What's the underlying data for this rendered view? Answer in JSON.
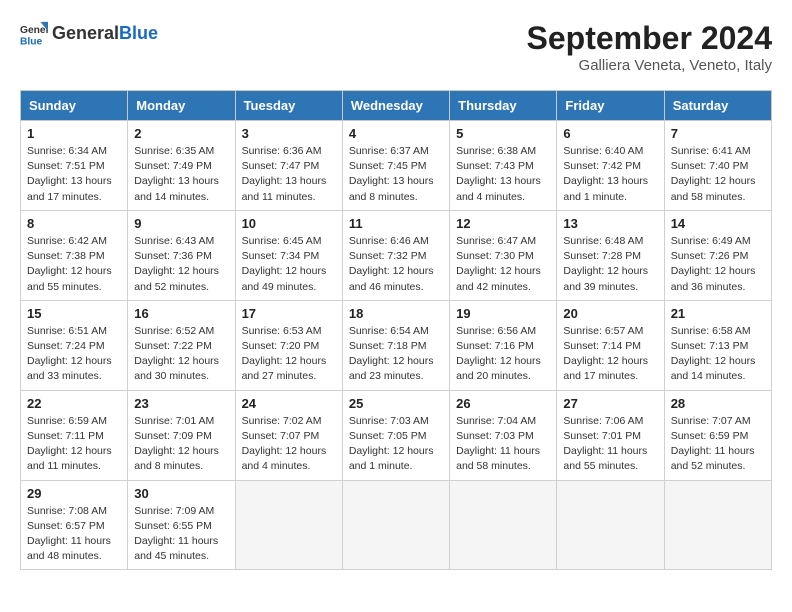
{
  "header": {
    "logo_general": "General",
    "logo_blue": "Blue",
    "month_year": "September 2024",
    "location": "Galliera Veneta, Veneto, Italy"
  },
  "calendar": {
    "days_of_week": [
      "Sunday",
      "Monday",
      "Tuesday",
      "Wednesday",
      "Thursday",
      "Friday",
      "Saturday"
    ],
    "weeks": [
      [
        {
          "day": "1",
          "sunrise": "6:34 AM",
          "sunset": "7:51 PM",
          "daylight": "13 hours and 17 minutes."
        },
        {
          "day": "2",
          "sunrise": "6:35 AM",
          "sunset": "7:49 PM",
          "daylight": "13 hours and 14 minutes."
        },
        {
          "day": "3",
          "sunrise": "6:36 AM",
          "sunset": "7:47 PM",
          "daylight": "13 hours and 11 minutes."
        },
        {
          "day": "4",
          "sunrise": "6:37 AM",
          "sunset": "7:45 PM",
          "daylight": "13 hours and 8 minutes."
        },
        {
          "day": "5",
          "sunrise": "6:38 AM",
          "sunset": "7:43 PM",
          "daylight": "13 hours and 4 minutes."
        },
        {
          "day": "6",
          "sunrise": "6:40 AM",
          "sunset": "7:42 PM",
          "daylight": "13 hours and 1 minute."
        },
        {
          "day": "7",
          "sunrise": "6:41 AM",
          "sunset": "7:40 PM",
          "daylight": "12 hours and 58 minutes."
        }
      ],
      [
        {
          "day": "8",
          "sunrise": "6:42 AM",
          "sunset": "7:38 PM",
          "daylight": "12 hours and 55 minutes."
        },
        {
          "day": "9",
          "sunrise": "6:43 AM",
          "sunset": "7:36 PM",
          "daylight": "12 hours and 52 minutes."
        },
        {
          "day": "10",
          "sunrise": "6:45 AM",
          "sunset": "7:34 PM",
          "daylight": "12 hours and 49 minutes."
        },
        {
          "day": "11",
          "sunrise": "6:46 AM",
          "sunset": "7:32 PM",
          "daylight": "12 hours and 46 minutes."
        },
        {
          "day": "12",
          "sunrise": "6:47 AM",
          "sunset": "7:30 PM",
          "daylight": "12 hours and 42 minutes."
        },
        {
          "day": "13",
          "sunrise": "6:48 AM",
          "sunset": "7:28 PM",
          "daylight": "12 hours and 39 minutes."
        },
        {
          "day": "14",
          "sunrise": "6:49 AM",
          "sunset": "7:26 PM",
          "daylight": "12 hours and 36 minutes."
        }
      ],
      [
        {
          "day": "15",
          "sunrise": "6:51 AM",
          "sunset": "7:24 PM",
          "daylight": "12 hours and 33 minutes."
        },
        {
          "day": "16",
          "sunrise": "6:52 AM",
          "sunset": "7:22 PM",
          "daylight": "12 hours and 30 minutes."
        },
        {
          "day": "17",
          "sunrise": "6:53 AM",
          "sunset": "7:20 PM",
          "daylight": "12 hours and 27 minutes."
        },
        {
          "day": "18",
          "sunrise": "6:54 AM",
          "sunset": "7:18 PM",
          "daylight": "12 hours and 23 minutes."
        },
        {
          "day": "19",
          "sunrise": "6:56 AM",
          "sunset": "7:16 PM",
          "daylight": "12 hours and 20 minutes."
        },
        {
          "day": "20",
          "sunrise": "6:57 AM",
          "sunset": "7:14 PM",
          "daylight": "12 hours and 17 minutes."
        },
        {
          "day": "21",
          "sunrise": "6:58 AM",
          "sunset": "7:13 PM",
          "daylight": "12 hours and 14 minutes."
        }
      ],
      [
        {
          "day": "22",
          "sunrise": "6:59 AM",
          "sunset": "7:11 PM",
          "daylight": "12 hours and 11 minutes."
        },
        {
          "day": "23",
          "sunrise": "7:01 AM",
          "sunset": "7:09 PM",
          "daylight": "12 hours and 8 minutes."
        },
        {
          "day": "24",
          "sunrise": "7:02 AM",
          "sunset": "7:07 PM",
          "daylight": "12 hours and 4 minutes."
        },
        {
          "day": "25",
          "sunrise": "7:03 AM",
          "sunset": "7:05 PM",
          "daylight": "12 hours and 1 minute."
        },
        {
          "day": "26",
          "sunrise": "7:04 AM",
          "sunset": "7:03 PM",
          "daylight": "11 hours and 58 minutes."
        },
        {
          "day": "27",
          "sunrise": "7:06 AM",
          "sunset": "7:01 PM",
          "daylight": "11 hours and 55 minutes."
        },
        {
          "day": "28",
          "sunrise": "7:07 AM",
          "sunset": "6:59 PM",
          "daylight": "11 hours and 52 minutes."
        }
      ],
      [
        {
          "day": "29",
          "sunrise": "7:08 AM",
          "sunset": "6:57 PM",
          "daylight": "11 hours and 48 minutes."
        },
        {
          "day": "30",
          "sunrise": "7:09 AM",
          "sunset": "6:55 PM",
          "daylight": "11 hours and 45 minutes."
        },
        null,
        null,
        null,
        null,
        null
      ]
    ],
    "labels": {
      "sunrise": "Sunrise:",
      "sunset": "Sunset:",
      "daylight": "Daylight:"
    }
  }
}
